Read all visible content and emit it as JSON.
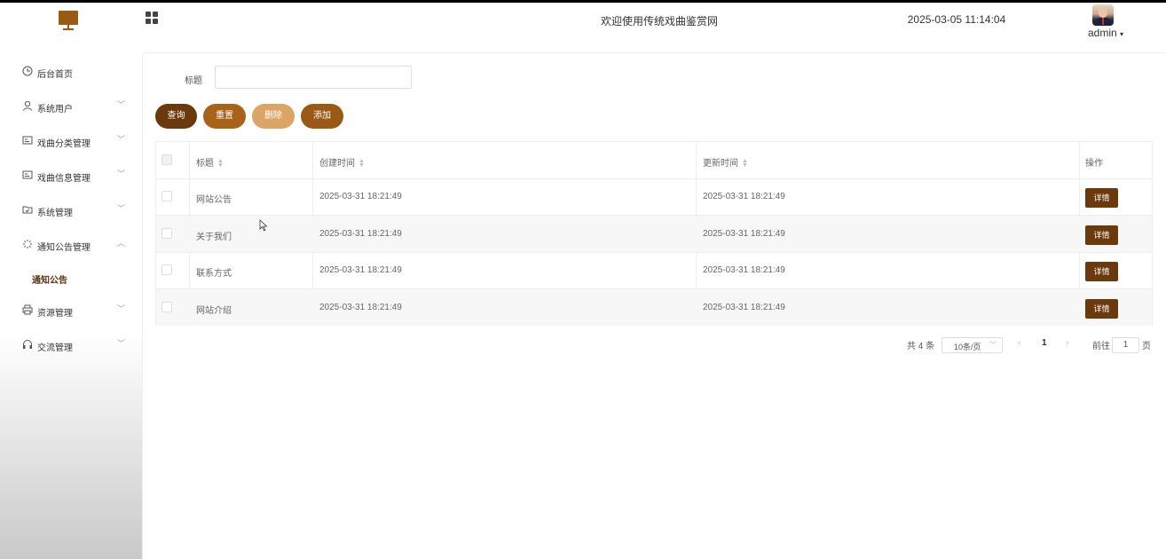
{
  "header": {
    "title": "欢迎使用传统戏曲鉴赏网",
    "datetime": "2025-03-05 11:14:04",
    "user": "admin",
    "brand_color": "#9b5a12"
  },
  "sidebar": {
    "items": [
      {
        "label": "后台首页",
        "icon": "clock-icon"
      },
      {
        "label": "系统用户",
        "icon": "user-icon"
      },
      {
        "label": "戏曲分类管理",
        "icon": "card-icon"
      },
      {
        "label": "戏曲信息管理",
        "icon": "card-icon"
      },
      {
        "label": "系统管理",
        "icon": "folder-icon"
      },
      {
        "label": "通知公告管理",
        "icon": "loading-icon"
      },
      {
        "label": "资源管理",
        "icon": "printer-icon"
      },
      {
        "label": "交流管理",
        "icon": "headset-icon"
      }
    ],
    "active_sub": "通知公告"
  },
  "search": {
    "label": "标题",
    "value": ""
  },
  "actions": {
    "query": "查询",
    "reset": "重置",
    "delete": "删除",
    "add": "添加"
  },
  "table": {
    "columns": [
      "标题",
      "创建时间",
      "更新时间",
      "操作"
    ],
    "rows": [
      {
        "title": "网站公告",
        "created": "2025-03-31 18:21:49",
        "updated": "2025-03-31 18:21:49",
        "action": "详情"
      },
      {
        "title": "关于我们",
        "created": "2025-03-31 18:21:49",
        "updated": "2025-03-31 18:21:49",
        "action": "详情"
      },
      {
        "title": "联系方式",
        "created": "2025-03-31 18:21:49",
        "updated": "2025-03-31 18:21:49",
        "action": "详情"
      },
      {
        "title": "网站介绍",
        "created": "2025-03-31 18:21:49",
        "updated": "2025-03-31 18:21:49",
        "action": "详情"
      }
    ]
  },
  "pagination": {
    "total": "共 4 条",
    "page_size": "10条/页",
    "current_page": "1",
    "goto_prefix": "前往",
    "goto_value": "1",
    "goto_suffix": "页"
  }
}
